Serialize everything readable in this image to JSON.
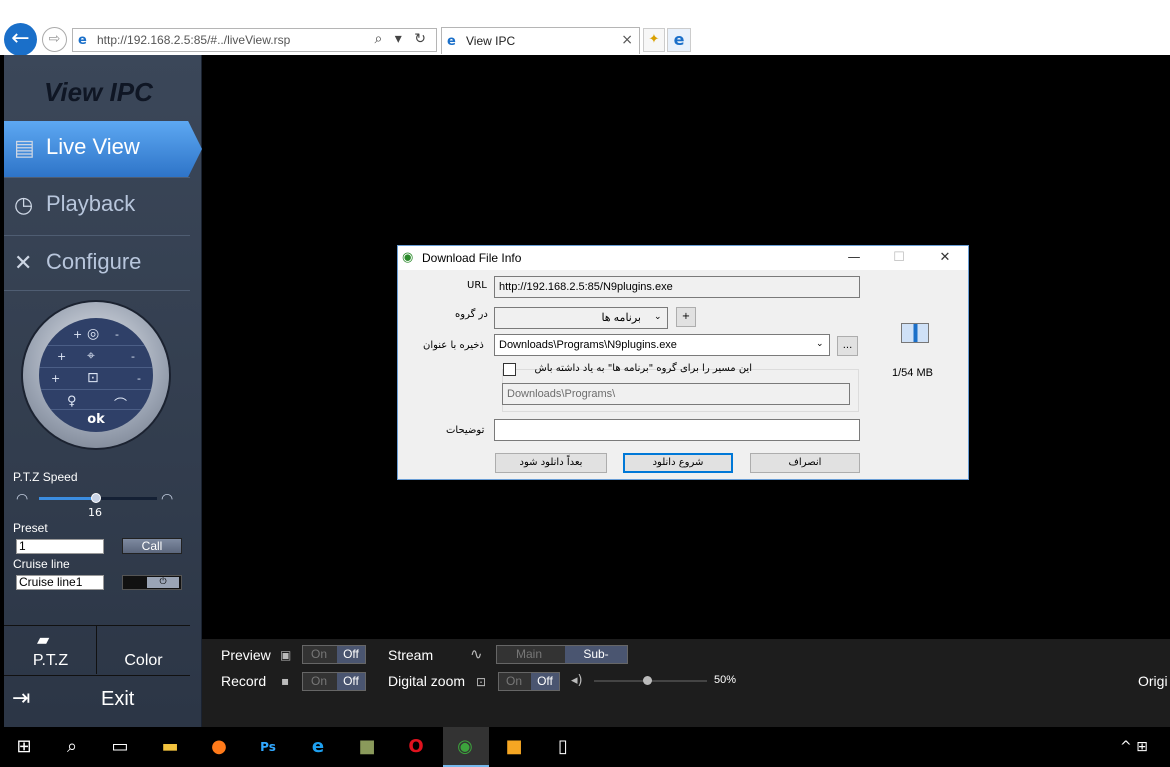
{
  "browser": {
    "url": "http://192.168.2.5:85/#../liveView.rsp",
    "tab_title": "View IPC",
    "url_tools": "⌕ ▾ ↻",
    "back_icon": "arrow-left-icon",
    "forward_icon": "arrow-right-icon"
  },
  "sidebar": {
    "title": "View IPC",
    "nav": [
      {
        "label": "Live View",
        "icon": "film-icon",
        "active": true
      },
      {
        "label": "Playback",
        "icon": "history-clock-icon"
      },
      {
        "label": "Configure",
        "icon": "tools-icon"
      }
    ],
    "ptz": {
      "row1_plus": "+",
      "row1_minus": "-",
      "row2_plus": "+",
      "row2_minus": "-",
      "row3_plus": "+",
      "row3_minus": "-",
      "ok": "ok"
    },
    "speed_label": "P.T.Z Speed",
    "speed_value": "16",
    "speed_fraction": 0.48,
    "preset_label": "Preset",
    "preset_value": "1",
    "call_label": "Call",
    "cruise_label": "Cruise line",
    "cruise_value": "Cruise line1",
    "tabs": {
      "ptz": "P.T.Z",
      "color": "Color"
    },
    "exit_label": "Exit"
  },
  "controls": {
    "preview_label": "Preview",
    "record_label": "Record",
    "on": "On",
    "off": "Off",
    "stream_label": "Stream",
    "stream_main": "Main",
    "stream_sub": "Sub-",
    "digital_zoom_label": "Digital zoom",
    "volume": "50%",
    "origin_label": "Origi"
  },
  "dialog": {
    "title": "Download File Info",
    "url_label": "URL",
    "url_value": "http://192.168.2.5:85/N9plugins.exe",
    "group_label": "در گروه",
    "group_value": "برنامه ها",
    "add_label": "+",
    "saveas_label": "ذخیره با عنوان",
    "saveas_value": "Downloads\\Programs\\N9plugins.exe",
    "browse_label": "...",
    "remember_label": "این مسیر را برای گروه \"برنامه ها\" به یاد داشته باش",
    "remember_path": "Downloads\\Programs\\",
    "desc_label": "توضیحات",
    "desc_value": "",
    "size": "1/54 MB",
    "later_label": "بعداً دانلود شود",
    "start_label": "شروع دانلود",
    "cancel_label": "انصراف",
    "minimize": "—",
    "maximize": "☐",
    "close": "✕"
  },
  "taskbar": {
    "icons": [
      "windows-start-icon",
      "search-icon",
      "task-view-icon",
      "file-explorer-icon",
      "firefox-icon",
      "photoshop-icon",
      "internet-explorer-icon",
      "game-icon",
      "opera-icon",
      "idm-icon",
      "app-icon",
      "document-icon"
    ],
    "tray": "^ ⊞"
  }
}
